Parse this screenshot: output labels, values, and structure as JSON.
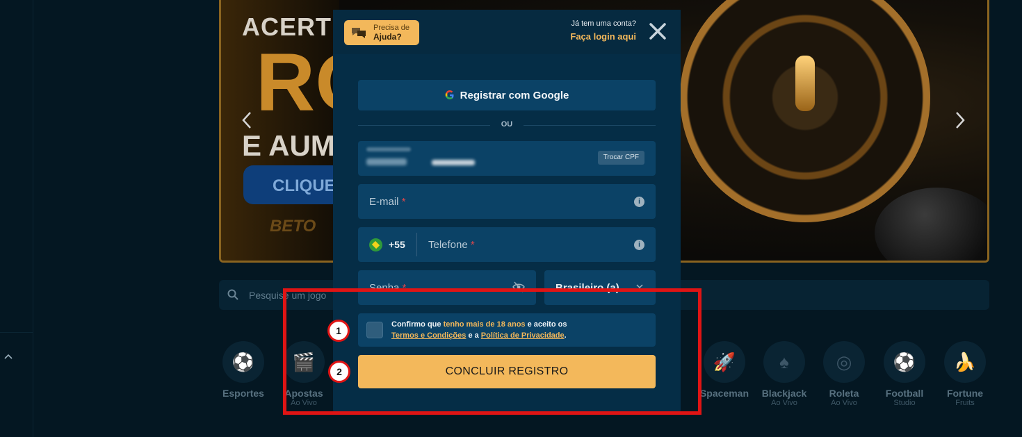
{
  "modal": {
    "help": {
      "line1": "Precisa de",
      "line2": "Ajuda?"
    },
    "login_prompt": "Já tem uma conta?",
    "login_link": "Faça login aqui",
    "google_label": "Registrar com Google",
    "divider_label": "OU",
    "cpf_swap_label": "Trocar CPF",
    "email_label": "E-mail",
    "phone_code": "+55",
    "phone_label": "Telefone",
    "password_label": "Senha",
    "nationality_value": "Brasileiro (a)",
    "required_mark": "*",
    "info_glyph": "i",
    "terms": {
      "part1": "Confirmo que ",
      "highlight": "tenho mais de 18 anos",
      "part2": " e aceito os",
      "link1": "Termos e Condições",
      "part3": " e a ",
      "link2": "Política de Privacidade",
      "part4": "."
    },
    "submit_label": "CONCLUIR REGISTRO"
  },
  "background": {
    "banner": {
      "headline": "ACERTE",
      "big_text": "RO",
      "line2": "E AUM",
      "cta": "CLIQUE",
      "logo": "BETO"
    },
    "search_placeholder": "Pesquise um jogo",
    "categories": [
      {
        "label": "Esportes",
        "sub": ""
      },
      {
        "label": "Apostas",
        "sub": "Ao Vivo"
      },
      {
        "label": "Spaceman",
        "sub": ""
      },
      {
        "label": "Blackjack",
        "sub": "Ao Vivo"
      },
      {
        "label": "Roleta",
        "sub": "Ao Vivo"
      },
      {
        "label": "Football",
        "sub": "Studio"
      },
      {
        "label": "Fortune",
        "sub": "Fruits"
      }
    ]
  },
  "annotations": {
    "marker1": "1",
    "marker2": "2"
  },
  "colors": {
    "accent": "#f3b85b",
    "modal_bg": "#052d46",
    "field_bg": "#0b4266",
    "annotation": "#e01414"
  }
}
